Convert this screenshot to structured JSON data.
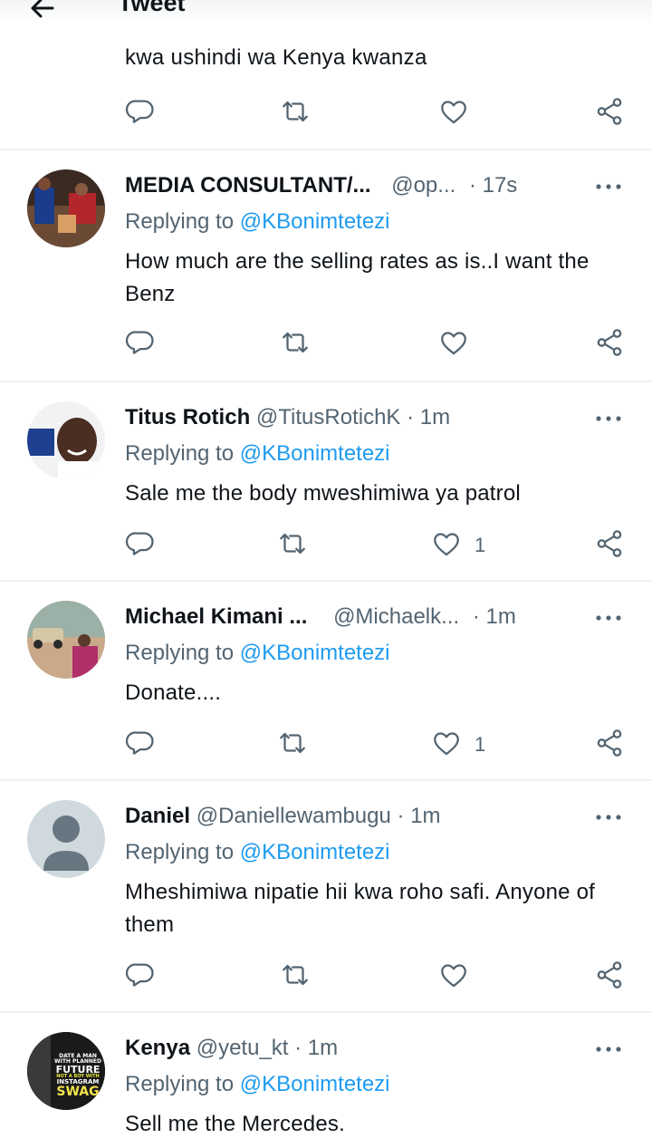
{
  "header": {
    "title": "Tweet"
  },
  "top_tweet": {
    "text": "kwa ushindi wa Kenya kwanza"
  },
  "icons": [
    "back-arrow-icon",
    "reply-icon",
    "retweet-icon",
    "like-icon",
    "share-icon",
    "more-icon"
  ],
  "colors": {
    "link": "#1d9bf0",
    "muted": "#536471",
    "text": "#0f1419",
    "divider": "#eef1f3"
  },
  "tweets": [
    {
      "name": "MEDIA CONSULTANT/...",
      "handle": "@op...",
      "time": "· 17s",
      "replying_label": "Replying to",
      "replying_to": "@KBonimtetezi",
      "text": "How much are the selling rates as is..I want the Benz",
      "likes": ""
    },
    {
      "name": "Titus Rotich",
      "handle": "@TitusRotichK",
      "time": "· 1m",
      "replying_label": "Replying to",
      "replying_to": "@KBonimtetezi",
      "text": "Sale me the body mweshimiwa ya patrol",
      "likes": "1"
    },
    {
      "name": "Michael Kimani ...",
      "handle": "@Michaelk...",
      "time": "· 1m",
      "replying_label": "Replying to",
      "replying_to": "@KBonimtetezi",
      "text": "Donate....",
      "likes": "1"
    },
    {
      "name": "Daniel",
      "handle": "@Daniellewambugu",
      "time": "· 1m",
      "replying_label": "Replying to",
      "replying_to": "@KBonimtetezi",
      "text": "Mheshimiwa nipatie hii kwa roho safi. Anyone of them",
      "likes": ""
    },
    {
      "name": "Kenya",
      "handle": "@yetu_kt",
      "time": "· 1m",
      "replying_label": "Replying to",
      "replying_to": "@KBonimtetezi",
      "text": "Sell me the Mercedes.",
      "likes": ""
    }
  ],
  "avatar_texts": {
    "kenya_poster": [
      "DATE A MAN",
      "WITH PLANNED",
      "FUTURE",
      "NOT A BOY WITH",
      "INSTAGRAM",
      "SWAG"
    ]
  }
}
